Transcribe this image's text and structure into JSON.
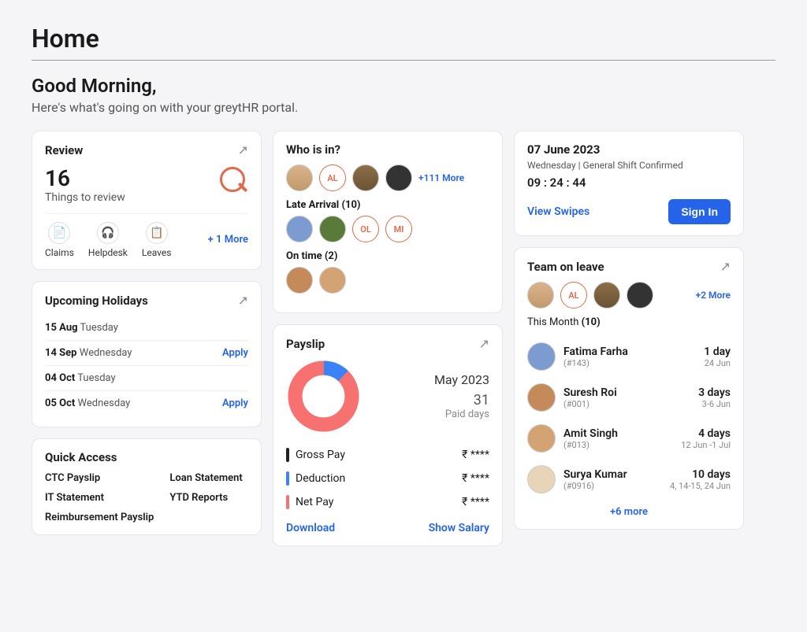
{
  "header": {
    "title": "Home",
    "greeting": "Good Morning,",
    "subtitle": "Here's what's going on with your greytHR portal."
  },
  "review": {
    "title": "Review",
    "count": "16",
    "subtitle": "Things to review",
    "items": [
      {
        "label": "Claims"
      },
      {
        "label": "Helpdesk"
      },
      {
        "label": "Leaves"
      }
    ],
    "more": "+ 1 More"
  },
  "holidays": {
    "title": "Upcoming Holidays",
    "rows": [
      {
        "date": "15 Aug",
        "day": "Tuesday",
        "apply": ""
      },
      {
        "date": "14 Sep",
        "day": "Wednesday",
        "apply": "Apply"
      },
      {
        "date": "04 Oct",
        "day": "Tuesday",
        "apply": ""
      },
      {
        "date": "05 Oct",
        "day": "Wednesday",
        "apply": "Apply"
      }
    ]
  },
  "quickAccess": {
    "title": "Quick Access",
    "col1": [
      "CTC Payslip",
      "IT Statement",
      "Reimbursement Payslip"
    ],
    "col2": [
      "Loan Statement",
      "YTD Reports"
    ]
  },
  "whois": {
    "title": "Who is in?",
    "topMore": "+111 More",
    "initials1": "AL",
    "lateLabel": "Late Arrival (10)",
    "lateInitials1": "OL",
    "lateInitials2": "MI",
    "ontimeLabel": "On time (2)"
  },
  "payslip": {
    "title": "Payslip",
    "month": "May 2023",
    "paidDays": "31",
    "paidDaysLabel": "Paid days",
    "lines": {
      "gross": {
        "label": "Gross Pay",
        "value": "₹ ****"
      },
      "ded": {
        "label": "Deduction",
        "value": "₹ ****"
      },
      "net": {
        "label": "Net Pay",
        "value": "₹ ****"
      }
    },
    "download": "Download",
    "showSalary": "Show Salary",
    "chart_data": {
      "type": "pie",
      "title": "",
      "series": [
        {
          "name": "Deduction",
          "value": 12,
          "color": "#3b82f6"
        },
        {
          "name": "Net Pay",
          "value": 88,
          "color": "#f87171"
        }
      ]
    }
  },
  "shift": {
    "date": "07 June 2023",
    "meta": "Wednesday | General Shift Confirmed",
    "clock": "09 : 24 : 44",
    "viewSwipes": "View Swipes",
    "signIn": "Sign In"
  },
  "teamLeave": {
    "title": "Team on leave",
    "initials1": "AL",
    "more": "+2 More",
    "monthLabel": "This Month",
    "monthCount": "(10)",
    "rows": [
      {
        "name": "Fatima Farha",
        "id": "(#143)",
        "days": "1 day",
        "dates": "24 Jun"
      },
      {
        "name": "Suresh Roi",
        "id": "(#001)",
        "days": "3 days",
        "dates": "3-6 Jun"
      },
      {
        "name": "Amit Singh",
        "id": "(#013)",
        "days": "4 days",
        "dates": "12 Jun -1 Jul"
      },
      {
        "name": "Surya Kumar",
        "id": "(#0916)",
        "days": "10 days",
        "dates": "4, 14-15, 24 Jun"
      }
    ],
    "moreBottom": "+6 more"
  }
}
